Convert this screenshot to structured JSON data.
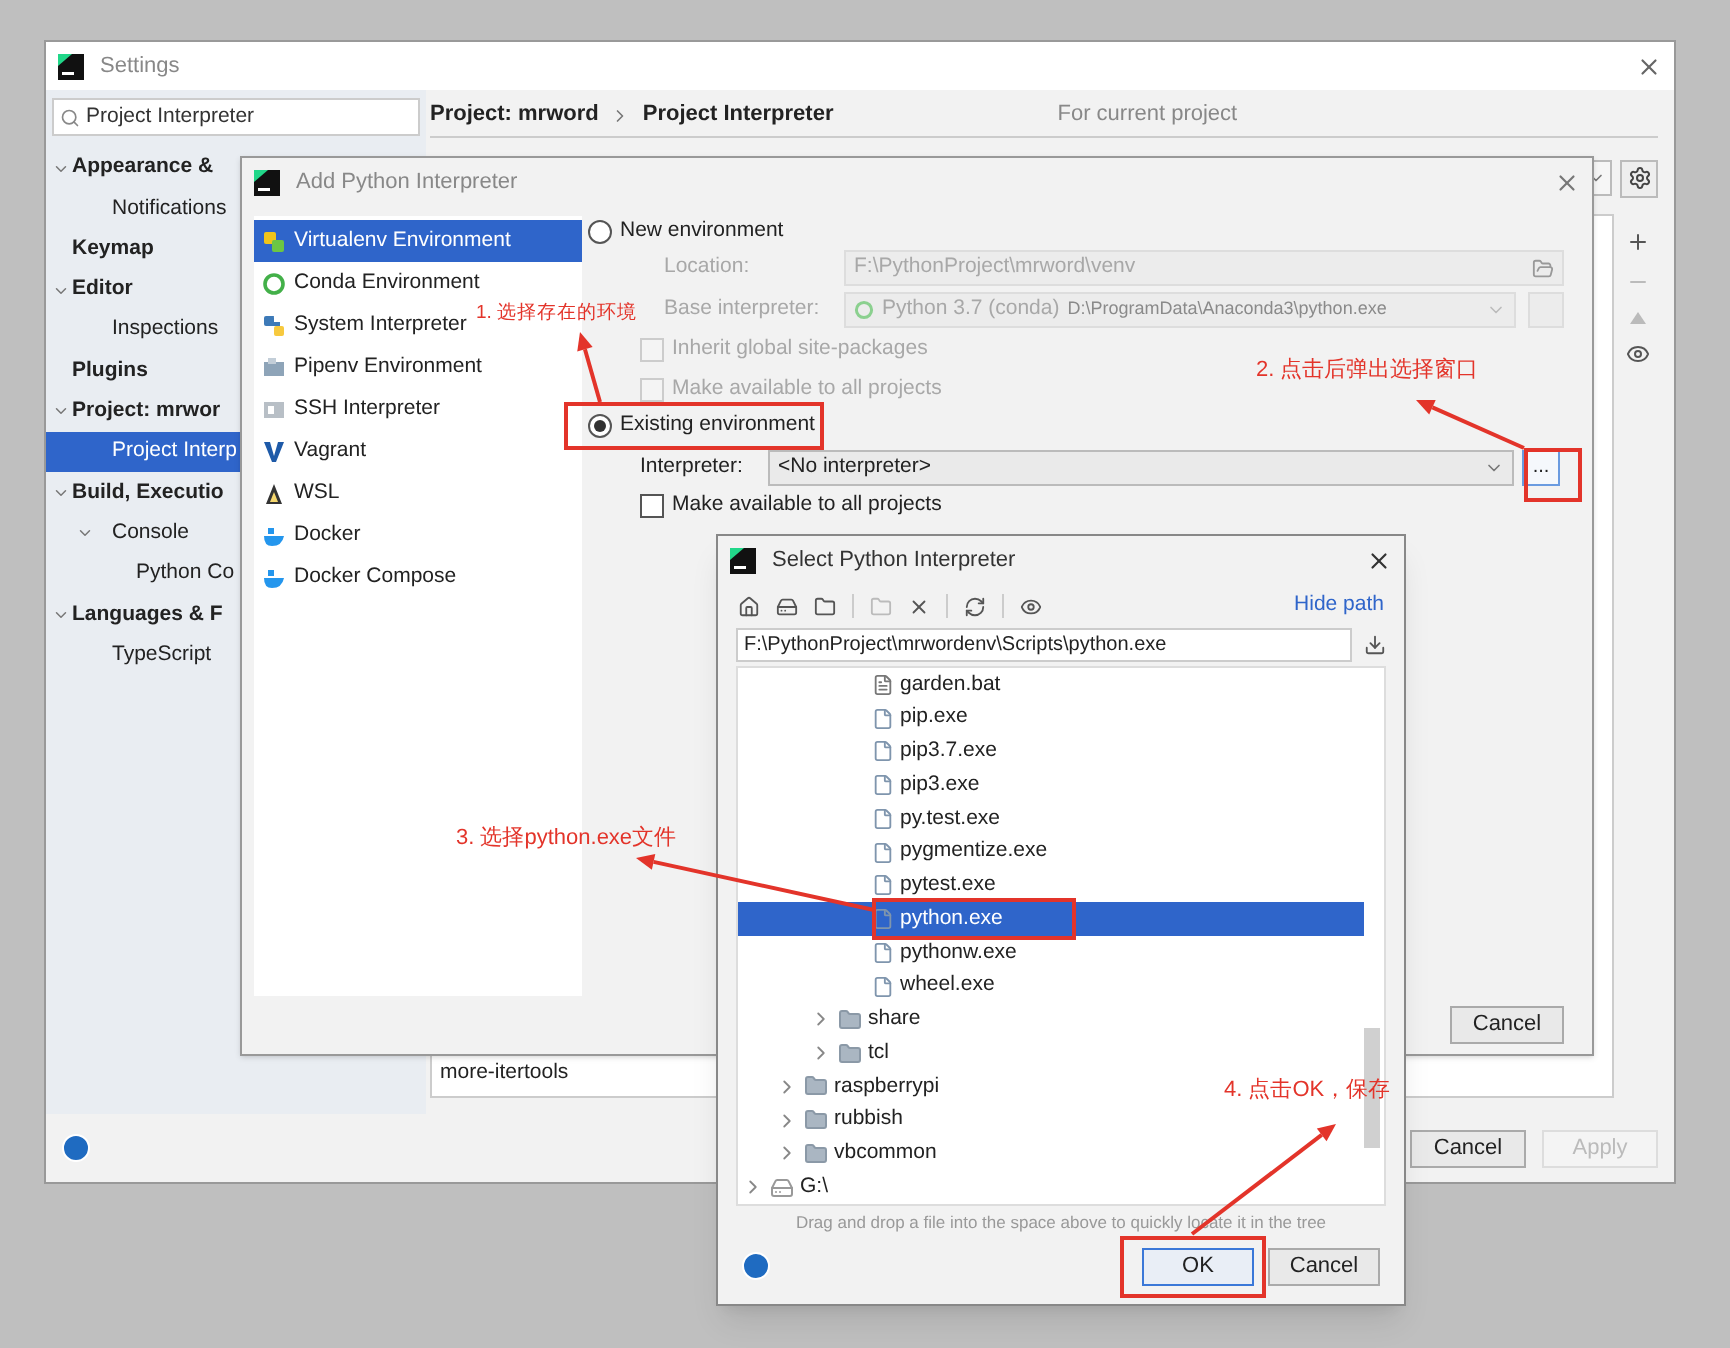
{
  "settings": {
    "title": "Settings",
    "search": {
      "value": "Project Interpreter"
    },
    "sidebar": [
      {
        "label": "Appearance &",
        "selected": false,
        "expanded": true,
        "children": [
          {
            "label": "Notifications",
            "selected": false
          }
        ]
      },
      {
        "label": "Keymap",
        "selected": false
      },
      {
        "label": "Editor",
        "selected": false,
        "expanded": true,
        "children": [
          {
            "label": "Inspections",
            "selected": false
          }
        ]
      },
      {
        "label": "Plugins",
        "selected": false
      },
      {
        "label": "Project: mrwor",
        "selected": false,
        "expanded": true,
        "children": [
          {
            "label": "Project Interp",
            "selected": true
          }
        ]
      },
      {
        "label": "Build, Executio",
        "selected": false,
        "expanded": true,
        "children": [
          {
            "label": "Console",
            "selected": false,
            "expanded": true,
            "children": [
              {
                "label": "Python Co",
                "selected": false
              }
            ]
          }
        ]
      },
      {
        "label": "Languages & F",
        "selected": false,
        "expanded": true,
        "children": [
          {
            "label": "TypeScript",
            "selected": false
          }
        ]
      }
    ],
    "breadcrumb": [
      "Project: mrword",
      "Project Interpreter"
    ],
    "scope": "For current project",
    "package_row": "more-itertools",
    "buttons": [
      {
        "label": "Cancel",
        "disabled": false
      },
      {
        "label": "Apply",
        "disabled": true
      }
    ]
  },
  "add_dialog": {
    "title": "Add Python Interpreter",
    "types": [
      {
        "label": "Virtualenv Environment",
        "selected": true
      },
      {
        "label": "Conda Environment",
        "selected": false
      },
      {
        "label": "System Interpreter",
        "selected": false
      },
      {
        "label": "Pipenv Environment",
        "selected": false
      },
      {
        "label": "SSH Interpreter",
        "selected": false
      },
      {
        "label": "Vagrant",
        "selected": false
      },
      {
        "label": "WSL",
        "selected": false
      },
      {
        "label": "Docker",
        "selected": false
      },
      {
        "label": "Docker Compose",
        "selected": false
      }
    ],
    "new_environment": {
      "label": "New environment",
      "selected": false
    },
    "location": {
      "label": "Location:",
      "value": "F:\\PythonProject\\mrword\\venv",
      "disabled": true
    },
    "base_interpreter": {
      "label": "Base interpreter:",
      "value": "Python 3.7 (conda)",
      "path": "D:\\ProgramData\\Anaconda3\\python.exe",
      "disabled": true
    },
    "inherit": {
      "label": "Inherit global site-packages",
      "checked": false,
      "disabled": true
    },
    "make_available_new": {
      "label": "Make available to all projects",
      "checked": false,
      "disabled": true
    },
    "existing_environment": {
      "label": "Existing environment",
      "selected": true
    },
    "interpreter": {
      "label": "Interpreter:",
      "value": "<No interpreter>"
    },
    "browse_button": "...",
    "make_available": {
      "label": "Make available to all projects",
      "checked": false
    },
    "buttons": [
      {
        "label": "Cancel"
      }
    ]
  },
  "select_dialog": {
    "title": "Select Python Interpreter",
    "hide_path": "Hide path",
    "path": "F:\\PythonProject\\mrwordenv\\Scripts\\python.exe",
    "tree": [
      {
        "children": [
          {
            "children": [
              {
                "children": [
                  {
                    "label": "garden.bat",
                    "kind": "script",
                    "selected": false
                  },
                  {
                    "label": "pip.exe",
                    "kind": "file",
                    "selected": false
                  },
                  {
                    "label": "pip3.7.exe",
                    "kind": "file",
                    "selected": false
                  },
                  {
                    "label": "pip3.exe",
                    "kind": "file",
                    "selected": false
                  },
                  {
                    "label": "py.test.exe",
                    "kind": "file",
                    "selected": false
                  },
                  {
                    "label": "pygmentize.exe",
                    "kind": "file",
                    "selected": false
                  },
                  {
                    "label": "pytest.exe",
                    "kind": "file",
                    "selected": false
                  },
                  {
                    "label": "python.exe",
                    "kind": "file",
                    "selected": true
                  },
                  {
                    "label": "pythonw.exe",
                    "kind": "file",
                    "selected": false
                  },
                  {
                    "label": "wheel.exe",
                    "kind": "file",
                    "selected": false
                  }
                ]
              },
              {
                "label": "share",
                "kind": "folder",
                "selected": false,
                "expanded": false
              },
              {
                "label": "tcl",
                "kind": "folder",
                "selected": false,
                "expanded": false
              }
            ]
          },
          {
            "label": "raspberrypi",
            "kind": "folder",
            "selected": false,
            "expanded": false
          },
          {
            "label": "rubbish",
            "kind": "folder",
            "selected": false,
            "expanded": false
          },
          {
            "label": "vbcommon",
            "kind": "folder",
            "selected": false,
            "expanded": false
          }
        ]
      },
      {
        "label": "G:\\",
        "kind": "drive",
        "selected": false,
        "expanded": false
      }
    ],
    "hint": "Drag and drop a file into the space above to quickly locate it in the tree",
    "buttons": [
      {
        "label": "OK",
        "default": true
      },
      {
        "label": "Cancel",
        "default": false
      }
    ]
  },
  "annotations": [
    {
      "text": "1. 选择存在的环境"
    },
    {
      "text": "2. 点击后弹出选择窗口"
    },
    {
      "text": "3. 选择python.exe文件"
    },
    {
      "text": "4. 点击OK，保存"
    }
  ]
}
